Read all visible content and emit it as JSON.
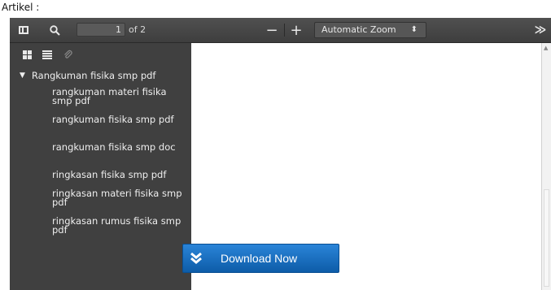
{
  "page": {
    "label": "Artikel :"
  },
  "toolbar": {
    "page_number": "1",
    "page_count": "of 2",
    "zoom_out": "−",
    "zoom_in": "+",
    "zoom_value": "Automatic Zoom",
    "zoom_chevron": "⬍",
    "more": "≫"
  },
  "outline": {
    "root": "Rangkuman fisika smp pdf",
    "items": [
      "rangkuman materi fisika smp pdf",
      "rangkuman fisika smp pdf",
      "rangkuman fisika smp doc",
      "ringkasan fisika smp pdf",
      "ringkasan materi fisika smp pdf",
      "ringkasan rumus fisika smp pdf"
    ]
  },
  "download": {
    "label": "Download Now"
  },
  "colors": {
    "toolbar": "#474747",
    "sidebar": "#404040",
    "download": "#1a6fc4"
  }
}
